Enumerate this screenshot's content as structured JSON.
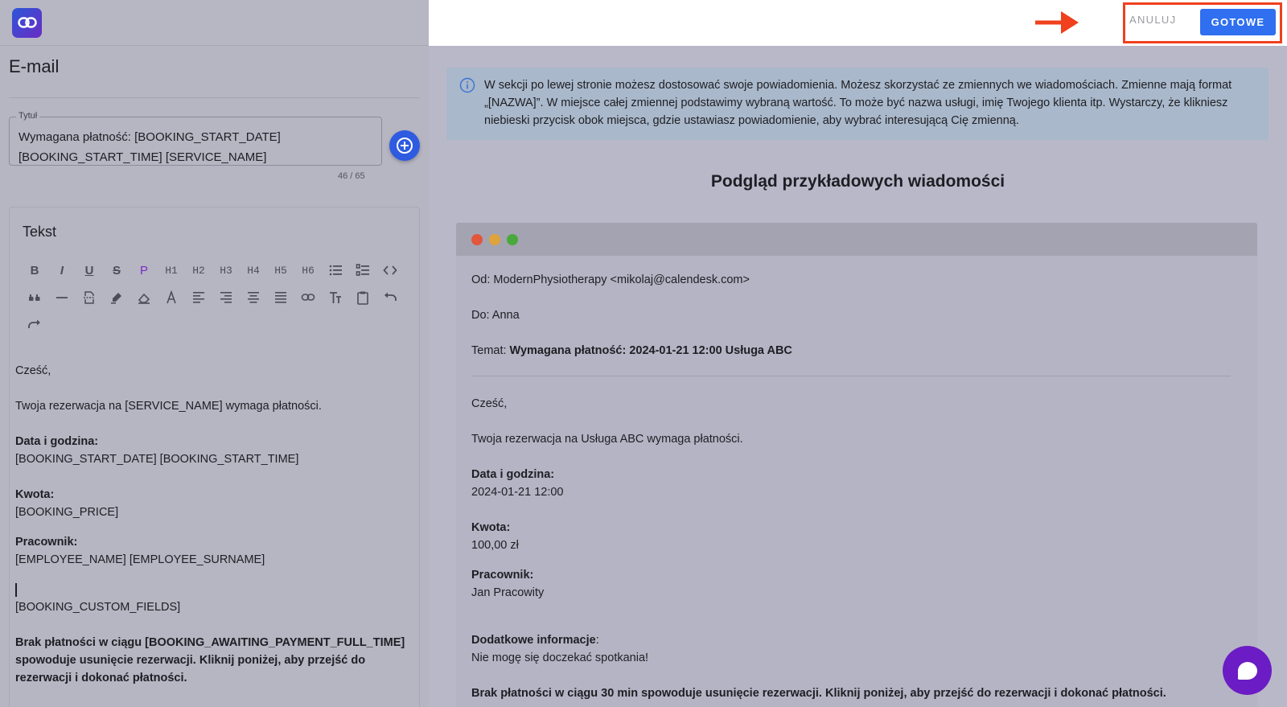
{
  "left": {
    "panel_title": "E-mail",
    "title_field": {
      "label": "Tytuł",
      "value_line1": "Wymagana płatność: [BOOKING_START_DATE]",
      "value_line2": "[BOOKING_START_TIME] [SERVICE_NAME]",
      "counter": "46 / 65"
    },
    "text_card": {
      "heading": "Tekst",
      "toolbar_row1": [
        "B",
        "I",
        "U",
        "S",
        "P",
        "H1",
        "H2",
        "H3",
        "H4",
        "H5",
        "H6",
        "bullet-list",
        "numbered-list",
        "code"
      ],
      "headings": [
        "H1",
        "H2",
        "H3",
        "H4",
        "H5",
        "H6"
      ],
      "paragraph_label": "P",
      "editor": {
        "greeting": "Cześć,",
        "line1": "Twoja rezerwacja na [SERVICE_NAME] wymaga płatności.",
        "date_label": "Data i godzina:",
        "date_value": "[BOOKING_START_DATE] [BOOKING_START_TIME]",
        "price_label": "Kwota:",
        "price_value": "[BOOKING_PRICE]",
        "employee_label": "Pracownik:",
        "employee_value": "[EMPLOYEE_NAME] [EMPLOYEE_SURNAME]",
        "custom_fields": "[BOOKING_CUSTOM_FIELDS]",
        "footer": "Brak płatności w ciągu [BOOKING_AWAITING_PAYMENT_FULL_TIME] spowoduje usunięcie rezerwacji. Kliknij poniżej, aby przejść do rezerwacji i dokonać płatności."
      }
    }
  },
  "topbar": {
    "cancel_label": "ANULUJ",
    "done_label": "GOTOWE",
    "accent_color": "#2f6ff0",
    "highlight_color": "#f0401e"
  },
  "right": {
    "info_text": "W sekcji po lewej stronie możesz dostosować swoje powiadomienia. Możesz skorzystać ze zmiennych we wiadomościach. Zmienne mają format „[NAZWA]”. W miejsce całej zmiennej podstawimy wybraną wartość. To może być nazwa usługi, imię Twojego klienta itp. Wystarczy, że klikniesz niebieski przycisk obok miejsca, gdzie ustawiasz powiadomienie, aby wybrać interesującą Cię zmienną.",
    "preview_title": "Podgląd przykładowych wiadomości",
    "mail": {
      "from": "Od: ModernPhysiotherapy <mikolaj@calendesk.com>",
      "to": "Do: Anna",
      "subject_label": "Temat: ",
      "subject_value": "Wymagana płatność: 2024-01-21 12:00 Usługa ABC",
      "greeting": "Cześć,",
      "line1": "Twoja rezerwacja na Usługa ABC wymaga płatności.",
      "date_label": "Data i godzina:",
      "date_value": "2024-01-21 12:00",
      "price_label": "Kwota:",
      "price_value": "100,00 zł",
      "employee_label": "Pracownik:",
      "employee_value": "Jan Pracowity",
      "extra_label": "Dodatkowe informacje",
      "extra_colon": ":",
      "extra_value": "Nie mogę się doczekać spotkania!",
      "footer": "Brak płatności w ciągu 30 min spowoduje usunięcie rezerwacji. Kliknij poniżej, aby przejść do rezerwacji i dokonać płatności."
    }
  }
}
